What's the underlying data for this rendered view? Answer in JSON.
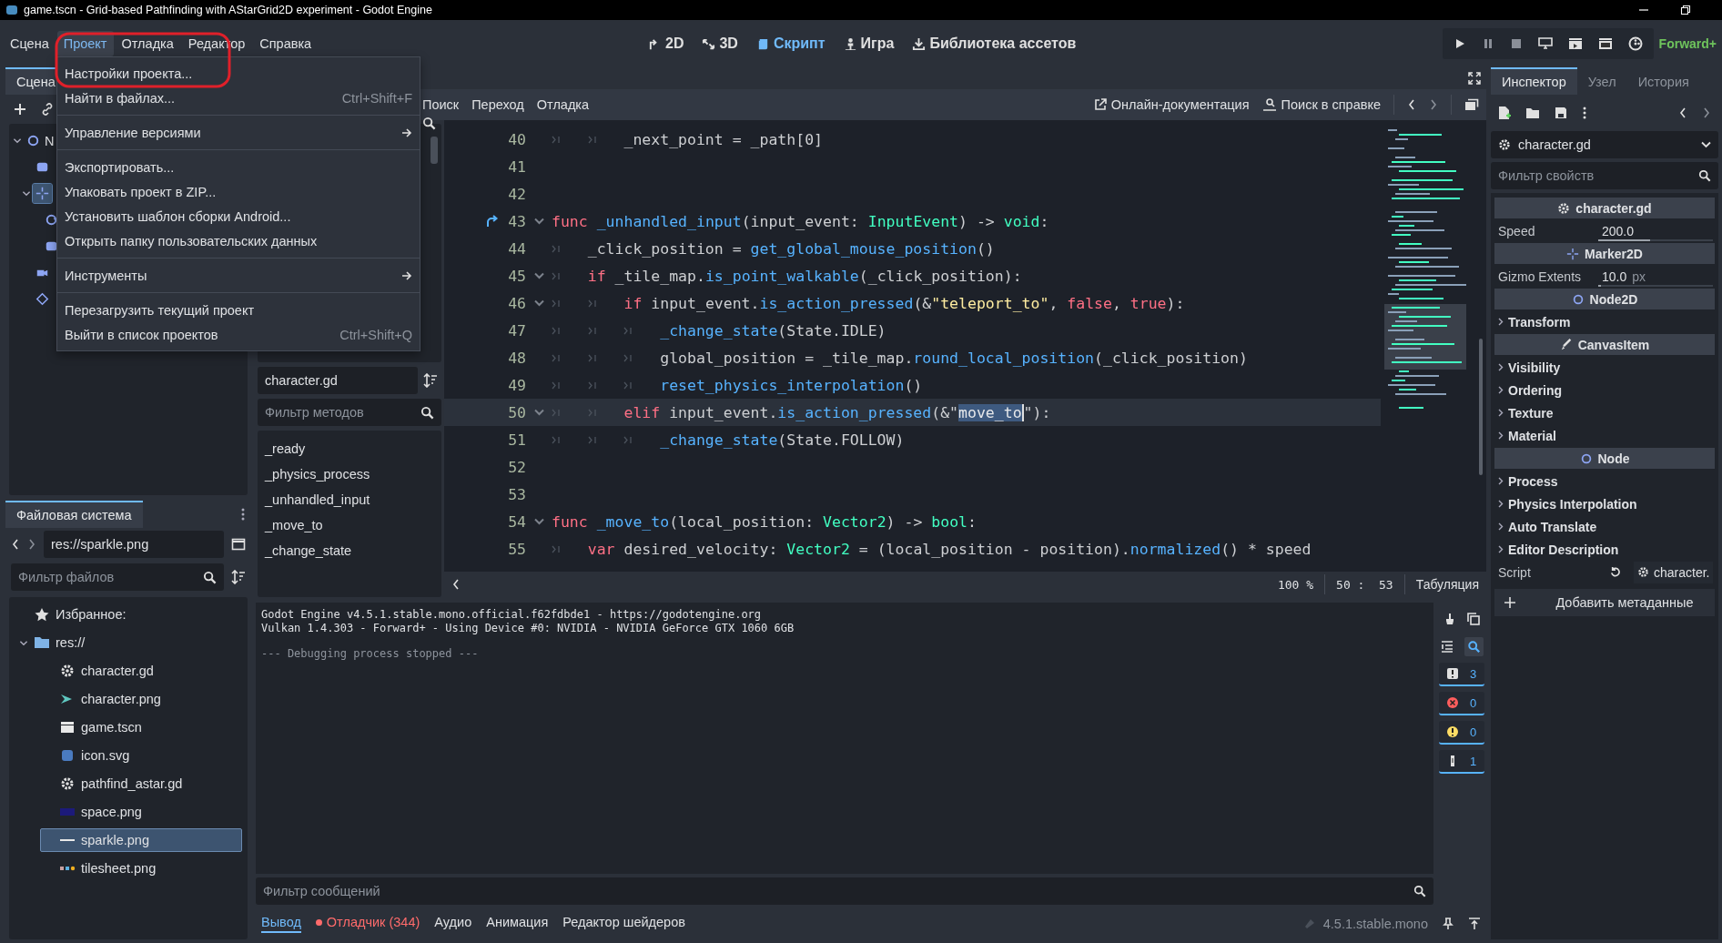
{
  "window": {
    "title": "game.tscn - Grid-based Pathfinding with AStarGrid2D experiment - Godot Engine"
  },
  "menu_bar": {
    "menus": [
      {
        "label": "Сцена",
        "selected": false
      },
      {
        "label": "Проект",
        "selected": true
      },
      {
        "label": "Отладка",
        "selected": false
      },
      {
        "label": "Редактор",
        "selected": false
      },
      {
        "label": "Справка",
        "selected": false
      }
    ],
    "workspaces": [
      {
        "label": "2D",
        "kind": "planar",
        "selected": false
      },
      {
        "label": "3D",
        "kind": "spatial",
        "selected": false
      },
      {
        "label": "Скрипт",
        "kind": "script",
        "selected": true
      },
      {
        "label": "Игра",
        "kind": "game",
        "selected": false
      },
      {
        "label": "Библиотека ассетов",
        "kind": "assetlib",
        "selected": false
      }
    ],
    "renderer": "Forward+"
  },
  "project_menu": [
    {
      "kind": "item",
      "label": "Настройки проекта..."
    },
    {
      "kind": "item",
      "label": "Найти в файлах...",
      "shortcut": "Ctrl+Shift+F"
    },
    {
      "kind": "separator"
    },
    {
      "kind": "submenu",
      "label": "Управление версиями"
    },
    {
      "kind": "separator"
    },
    {
      "kind": "item",
      "label": "Экспортировать..."
    },
    {
      "kind": "item",
      "label": "Упаковать проект в ZIP..."
    },
    {
      "kind": "item",
      "label": "Установить шаблон сборки Android..."
    },
    {
      "kind": "item",
      "label": "Открыть папку пользовательских данных"
    },
    {
      "kind": "separator"
    },
    {
      "kind": "submenu",
      "label": "Инструменты"
    },
    {
      "kind": "separator"
    },
    {
      "kind": "item",
      "label": "Перезагрузить текущий проект"
    },
    {
      "kind": "item",
      "label": "Выйти в список проектов",
      "shortcut": "Ctrl+Shift+Q"
    }
  ],
  "scene_dock": {
    "tab": "Сцена",
    "tree": [
      {
        "label": "N",
        "kind": "node",
        "expanded": true,
        "selected": false,
        "children": [
          {
            "kind": "sprite",
            "selected": false
          },
          {
            "kind": "marker",
            "expanded": true,
            "selected": true,
            "children": [
              {
                "kind": "agent",
                "selected": false
              },
              {
                "kind": "sprite",
                "selected": false
              }
            ]
          },
          {
            "kind": "camera",
            "selected": false
          },
          {
            "kind": "tilemap",
            "selected": false
          }
        ]
      }
    ]
  },
  "filesystem_dock": {
    "tab": "Файловая система",
    "path": "res://sparkle.png",
    "filter": {
      "placeholder": "Фильтр файлов"
    },
    "tree": [
      {
        "label": "Избранное:",
        "kind": "star",
        "selected": false
      },
      {
        "label": "res://",
        "kind": "folder",
        "expanded": true,
        "selected": false,
        "children": [
          {
            "label": "character.gd",
            "kind": "script",
            "selected": false
          },
          {
            "label": "character.png",
            "kind": "image",
            "selected": false
          },
          {
            "label": "game.tscn",
            "kind": "scene",
            "selected": false
          },
          {
            "label": "icon.svg",
            "kind": "svg",
            "selected": false
          },
          {
            "label": "pathfind_astar.gd",
            "kind": "script",
            "selected": false
          },
          {
            "label": "space.png",
            "kind": "space",
            "selected": false
          },
          {
            "label": "sparkle.png",
            "kind": "line",
            "selected": true
          },
          {
            "label": "tilesheet.png",
            "kind": "tiles",
            "selected": false
          }
        ]
      }
    ]
  },
  "script_editor": {
    "menus": [
      "Поиск",
      "Переход",
      "Отладка"
    ],
    "online_docs": "Онлайн-документация",
    "search_help": "Поиск в справке",
    "current_script": "character.gd",
    "method_filter": {
      "placeholder": "Фильтр методов"
    },
    "methods": [
      "_ready",
      "_physics_process",
      "_unhandled_input",
      "_move_to",
      "_change_state"
    ],
    "lines": [
      {
        "number": "40",
        "fold": false,
        "current": false,
        "jump": false,
        "tokens": [
          {
            "kind": "tab"
          },
          {
            "kind": "tab"
          },
          {
            "kind": "plain",
            "text": "_next_point = _path[0]"
          }
        ]
      },
      {
        "number": "41",
        "fold": false,
        "current": false,
        "jump": false
      },
      {
        "number": "42",
        "fold": false,
        "current": false,
        "jump": false
      },
      {
        "number": "43",
        "fold": true,
        "current": false,
        "jump": true,
        "tokens": [
          {
            "kind": "kw",
            "text": "func"
          },
          {
            "kind": "fn",
            "text": " _unhandled_input"
          },
          {
            "kind": "plain",
            "text": "(input_event: "
          },
          {
            "kind": "type",
            "text": "InputEvent"
          },
          {
            "kind": "plain",
            "text": ") -> "
          },
          {
            "kind": "type",
            "text": "void"
          },
          {
            "kind": "plain",
            "text": ":"
          }
        ]
      },
      {
        "number": "44",
        "fold": false,
        "current": false,
        "jump": false,
        "tokens": [
          {
            "kind": "tab"
          },
          {
            "kind": "plain",
            "text": "_click_position = "
          },
          {
            "kind": "fn",
            "text": "get_global_mouse_position"
          },
          {
            "kind": "plain",
            "text": "()"
          }
        ]
      },
      {
        "number": "45",
        "fold": true,
        "current": false,
        "jump": false,
        "tokens": [
          {
            "kind": "tab"
          },
          {
            "kind": "kw",
            "text": "if"
          },
          {
            "kind": "plain",
            "text": " _tile_map."
          },
          {
            "kind": "fn",
            "text": "is_point_walkable"
          },
          {
            "kind": "plain",
            "text": "(_click_position):"
          }
        ]
      },
      {
        "number": "46",
        "fold": true,
        "current": false,
        "jump": false,
        "tokens": [
          {
            "kind": "tab"
          },
          {
            "kind": "tab"
          },
          {
            "kind": "kw",
            "text": "if"
          },
          {
            "kind": "plain",
            "text": " input_event."
          },
          {
            "kind": "fn",
            "text": "is_action_pressed"
          },
          {
            "kind": "plain",
            "text": "(&"
          },
          {
            "kind": "str",
            "text": "\"teleport_to\""
          },
          {
            "kind": "plain",
            "text": ", "
          },
          {
            "kind": "kw",
            "text": "false"
          },
          {
            "kind": "plain",
            "text": ", "
          },
          {
            "kind": "kw",
            "text": "true"
          },
          {
            "kind": "plain",
            "text": "):"
          }
        ]
      },
      {
        "number": "47",
        "fold": false,
        "current": false,
        "jump": false,
        "tokens": [
          {
            "kind": "tab"
          },
          {
            "kind": "tab"
          },
          {
            "kind": "tab"
          },
          {
            "kind": "fn",
            "text": "_change_state"
          },
          {
            "kind": "plain",
            "text": "(State.IDLE)"
          }
        ]
      },
      {
        "number": "48",
        "fold": false,
        "current": false,
        "jump": false,
        "tokens": [
          {
            "kind": "tab"
          },
          {
            "kind": "tab"
          },
          {
            "kind": "tab"
          },
          {
            "kind": "plain",
            "text": "global_position = _tile_map."
          },
          {
            "kind": "fn",
            "text": "round_local_position"
          },
          {
            "kind": "plain",
            "text": "(_click_position)"
          }
        ]
      },
      {
        "number": "49",
        "fold": false,
        "current": false,
        "jump": false,
        "tokens": [
          {
            "kind": "tab"
          },
          {
            "kind": "tab"
          },
          {
            "kind": "tab"
          },
          {
            "kind": "fn",
            "text": "reset_physics_interpolation"
          },
          {
            "kind": "plain",
            "text": "()"
          }
        ]
      },
      {
        "number": "50",
        "fold": true,
        "current": true,
        "jump": false,
        "tokens": [
          {
            "kind": "tab"
          },
          {
            "kind": "tab"
          },
          {
            "kind": "kw",
            "text": "elif"
          },
          {
            "kind": "plain",
            "text": " input_event."
          },
          {
            "kind": "fn",
            "text": "is_action_pressed"
          },
          {
            "kind": "plain",
            "text": "(&\""
          },
          {
            "kind": "sel",
            "text": "move_to"
          },
          {
            "kind": "plain",
            "text": "\"):"
          }
        ]
      },
      {
        "number": "51",
        "fold": false,
        "current": false,
        "jump": false,
        "tokens": [
          {
            "kind": "tab"
          },
          {
            "kind": "tab"
          },
          {
            "kind": "tab"
          },
          {
            "kind": "fn",
            "text": "_change_state"
          },
          {
            "kind": "plain",
            "text": "(State.FOLLOW)"
          }
        ]
      },
      {
        "number": "52",
        "fold": false,
        "current": false,
        "jump": false
      },
      {
        "number": "53",
        "fold": false,
        "current": false,
        "jump": false
      },
      {
        "number": "54",
        "fold": true,
        "current": false,
        "jump": false,
        "tokens": [
          {
            "kind": "kw",
            "text": "func"
          },
          {
            "kind": "fn",
            "text": " _move_to"
          },
          {
            "kind": "plain",
            "text": "(local_position: "
          },
          {
            "kind": "type",
            "text": "Vector2"
          },
          {
            "kind": "plain",
            "text": ") -> "
          },
          {
            "kind": "type",
            "text": "bool"
          },
          {
            "kind": "plain",
            "text": ":"
          }
        ]
      },
      {
        "number": "55",
        "fold": false,
        "current": false,
        "jump": false,
        "tokens": [
          {
            "kind": "tab"
          },
          {
            "kind": "kw",
            "text": "var"
          },
          {
            "kind": "plain",
            "text": " desired_velocity: "
          },
          {
            "kind": "type",
            "text": "Vector2"
          },
          {
            "kind": "plain",
            "text": " = (local_position - position)."
          },
          {
            "kind": "fn",
            "text": "normalized"
          },
          {
            "kind": "plain",
            "text": "() * speed"
          }
        ]
      }
    ],
    "status": {
      "zoom": "100 %",
      "position": "50 :  53",
      "indent": "Табуляция"
    }
  },
  "bottom_panel": {
    "output": [
      {
        "kind": "normal",
        "text": "Godot Engine v4.5.1.stable.mono.official.f62fdbde1 - https://godotengine.org"
      },
      {
        "kind": "normal",
        "text": "Vulkan 1.4.303 - Forward+ - Using Device #0: NVIDIA - NVIDIA GeForce GTX 1060 6GB"
      },
      {
        "kind": "faint",
        "text": "--- Debugging process stopped ---"
      }
    ],
    "filters": [
      {
        "kind": "message",
        "count": "3",
        "selected": true
      },
      {
        "kind": "error",
        "count": "0",
        "selected": true
      },
      {
        "kind": "warning",
        "count": "0",
        "selected": true
      },
      {
        "kind": "editor",
        "count": "1",
        "selected": true
      }
    ],
    "message_filter": {
      "placeholder": "Фильтр сообщений"
    },
    "tabs": [
      {
        "label": "Вывод",
        "kind": "normal",
        "selected": true
      },
      {
        "label": "Отладчик (344)",
        "kind": "error",
        "selected": false
      },
      {
        "label": "Аудио",
        "kind": "normal",
        "selected": false
      },
      {
        "label": "Анимация",
        "kind": "normal",
        "selected": false
      },
      {
        "label": "Редактор шейдеров",
        "kind": "normal",
        "selected": false
      }
    ],
    "version": "4.5.1.stable.mono"
  },
  "inspector": {
    "tabs": [
      {
        "label": "Инспектор",
        "selected": true
      },
      {
        "label": "Узел",
        "selected": false
      },
      {
        "label": "История",
        "selected": false
      }
    ],
    "resource": "character.gd",
    "filter": {
      "placeholder": "Фильтр свойств"
    },
    "properties": [
      {
        "kind": "script_section",
        "label": "character.gd"
      },
      {
        "kind": "number",
        "label": "Speed",
        "value": "200.0",
        "level": 0.45
      },
      {
        "kind": "marker_section",
        "label": "Marker2D"
      },
      {
        "kind": "number",
        "label": "Gizmo Extents",
        "value": "10.0",
        "suffix": "px",
        "level": 0.02
      },
      {
        "kind": "node_section",
        "label": "Node2D"
      },
      {
        "kind": "group",
        "label": "Transform"
      },
      {
        "kind": "canvas_section",
        "label": "CanvasItem"
      },
      {
        "kind": "group",
        "label": "Visibility"
      },
      {
        "kind": "group",
        "label": "Ordering"
      },
      {
        "kind": "group",
        "label": "Texture"
      },
      {
        "kind": "group",
        "label": "Material"
      },
      {
        "kind": "node_section",
        "label": "Node"
      },
      {
        "kind": "group",
        "label": "Process"
      },
      {
        "kind": "group",
        "label": "Physics Interpolation"
      },
      {
        "kind": "group",
        "label": "Auto Translate"
      },
      {
        "kind": "group",
        "label": "Editor Description"
      },
      {
        "kind": "resource",
        "label": "Script",
        "value": "character."
      }
    ],
    "add_metadata": "Добавить метаданные"
  }
}
